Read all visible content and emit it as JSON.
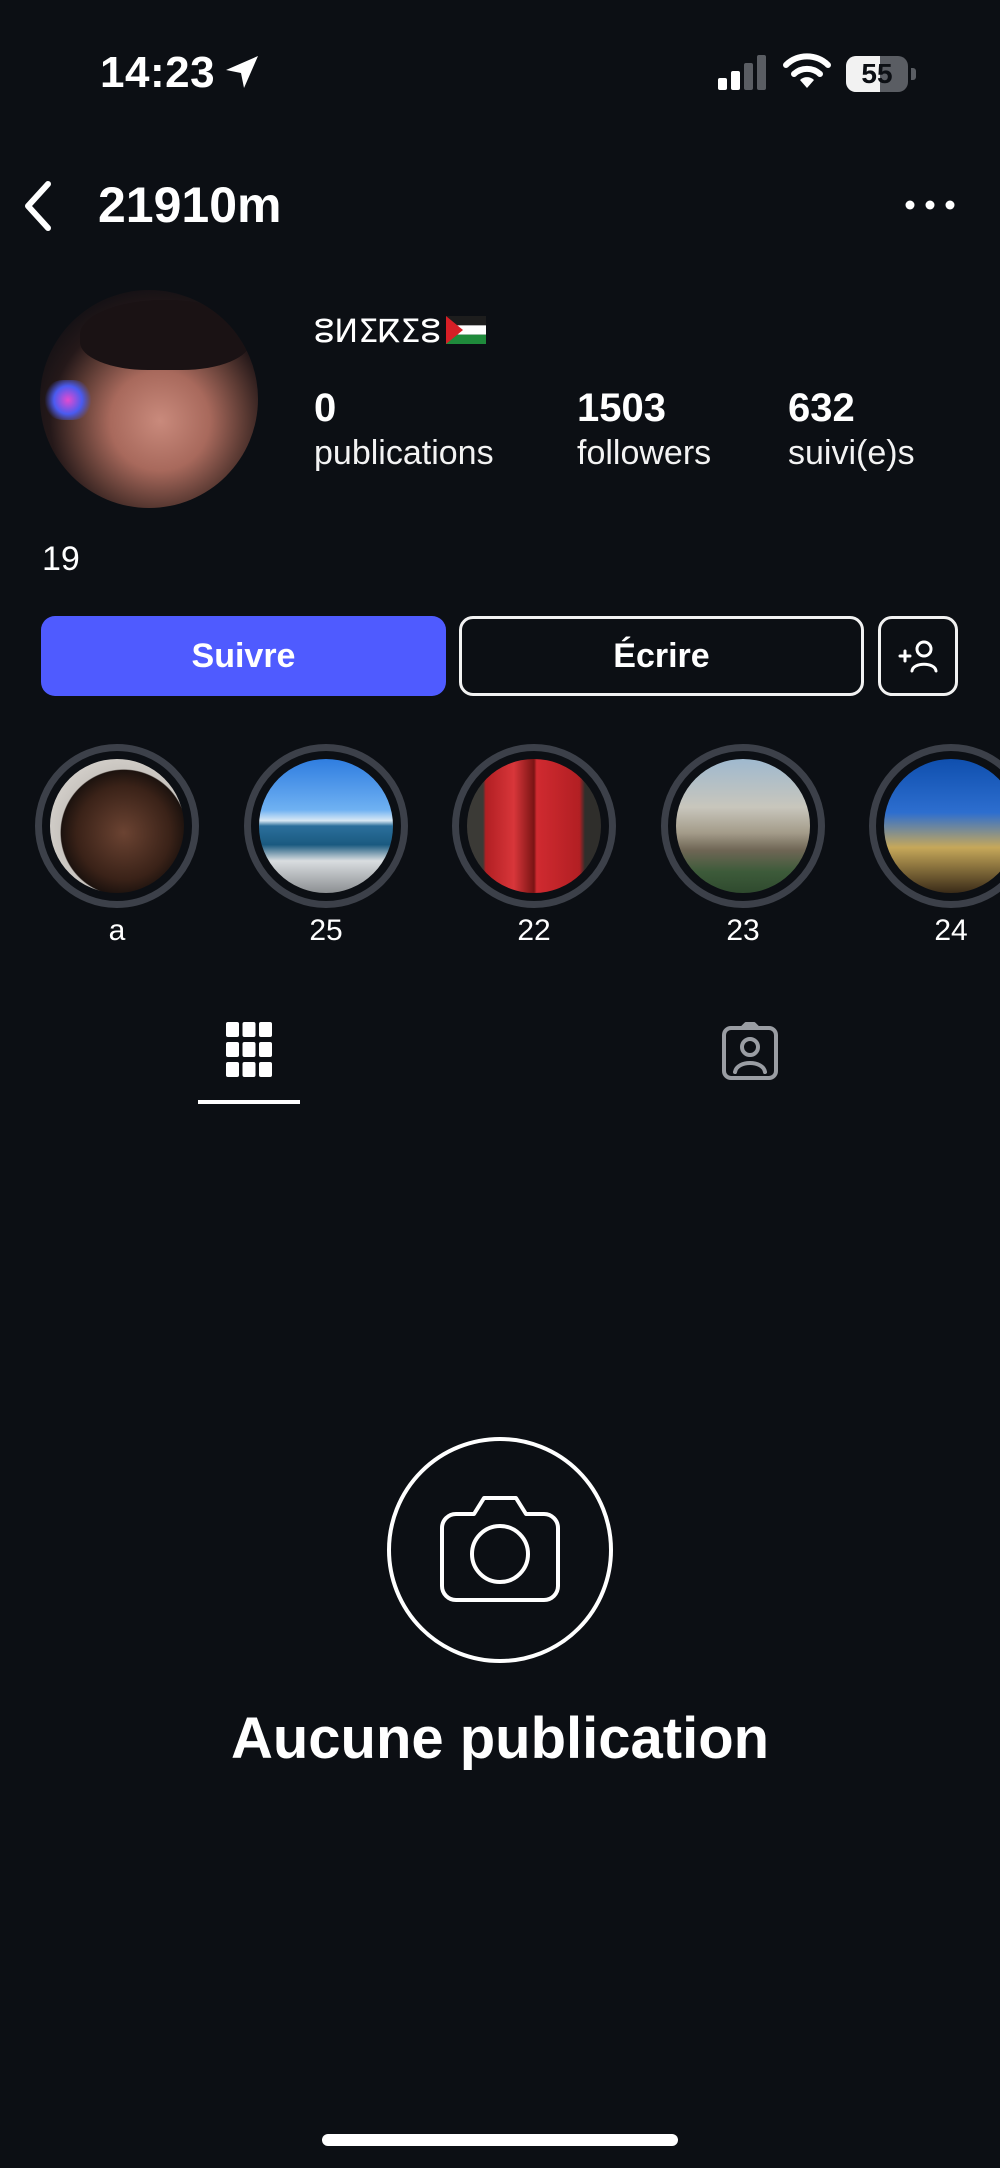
{
  "status_bar": {
    "time": "14:23",
    "battery_level": "55",
    "battery_fraction": 0.55
  },
  "header": {
    "username": "21910m",
    "back_icon": "chevron-left-icon",
    "more_icon": "ellipsis-icon"
  },
  "profile": {
    "display_name": "ⵓⵍⵉⴽⵉⵓ",
    "flag": "palestine-flag",
    "stats": [
      {
        "value": "0",
        "label": "publications"
      },
      {
        "value": "1503",
        "label": "followers"
      },
      {
        "value": "632",
        "label": "suivi(e)s"
      }
    ],
    "bio": "19"
  },
  "actions": {
    "follow_label": "Suivre",
    "message_label": "Écrire",
    "add_icon": "add-person-icon"
  },
  "highlights": [
    {
      "label": "a"
    },
    {
      "label": "25"
    },
    {
      "label": "22"
    },
    {
      "label": "23"
    },
    {
      "label": "24"
    }
  ],
  "tabs": {
    "grid_icon": "grid-icon",
    "tagged_icon": "tagged-person-icon"
  },
  "empty_state": {
    "icon": "camera-icon",
    "title": "Aucune publication"
  },
  "colors": {
    "background": "#0c0f14",
    "accent": "#4f5bff",
    "ring": "#3c4049"
  }
}
